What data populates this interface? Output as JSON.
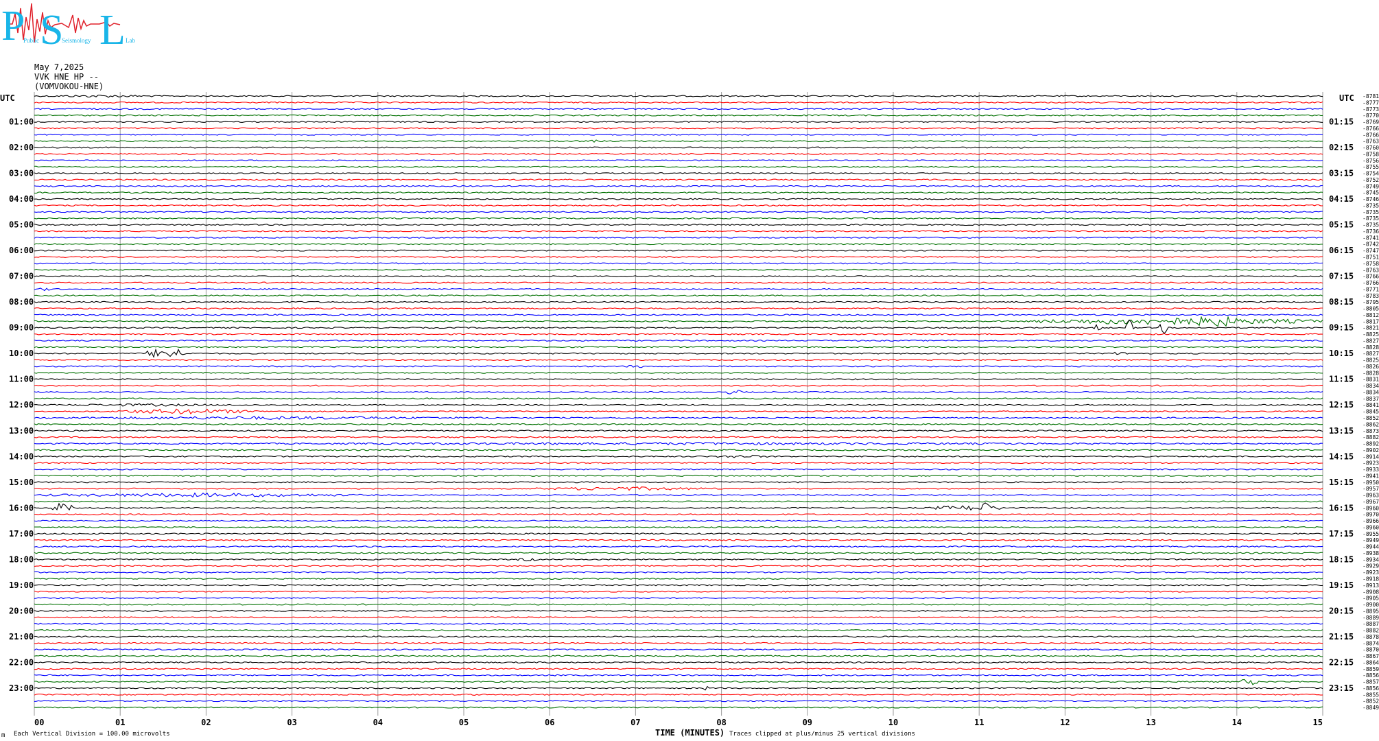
{
  "logo": {
    "letters": [
      "P",
      "S",
      "L"
    ],
    "small_words": [
      "Public",
      "Seismology",
      "Lab"
    ]
  },
  "header": {
    "date": "May 7,2025",
    "station": "VVK HNE HP --",
    "channel": "(VOMVOKOU-HNE)"
  },
  "colors": {
    "black": "#000000",
    "red": "#ff0000",
    "blue": "#0000ff",
    "green": "#007000",
    "grid": "#9a9a9a",
    "logo": "#19b5e8",
    "logo_signal": "#e0202a"
  },
  "chart_data": {
    "type": "line",
    "description_of_rows": "helicorder: one trace per 15 minutes, colours cycle black, red, blue, green",
    "left_axis_title": "UTC",
    "right_axis_title": "UTC",
    "left_labels": [
      "01:00",
      "02:00",
      "03:00",
      "04:00",
      "05:00",
      "06:00",
      "07:00",
      "08:00",
      "09:00",
      "10:00",
      "11:00",
      "12:00",
      "13:00",
      "14:00",
      "15:00",
      "16:00",
      "17:00",
      "18:00",
      "19:00",
      "20:00",
      "21:00",
      "22:00",
      "23:00"
    ],
    "right_labels": [
      "01:15",
      "02:15",
      "03:15",
      "04:15",
      "05:15",
      "06:15",
      "07:15",
      "08:15",
      "09:15",
      "10:15",
      "11:15",
      "12:15",
      "13:15",
      "14:15",
      "15:15",
      "16:15",
      "17:15",
      "18:15",
      "19:15",
      "20:15",
      "21:15",
      "22:15",
      "23:15"
    ],
    "trace_colors": [
      "#000000",
      "#ff0000",
      "#0000ff",
      "#007000"
    ],
    "row_counts": [
      -8781,
      -8777,
      -8773,
      -8770,
      -8769,
      -8766,
      -8766,
      -8763,
      -8760,
      -8758,
      -8756,
      -8755,
      -8754,
      -8752,
      -8749,
      -8745,
      -8746,
      -8735,
      -8735,
      -8735,
      -8735,
      -8736,
      -8741,
      -8742,
      -8747,
      -8751,
      -8758,
      -8763,
      -8766,
      -8766,
      -8771,
      -8783,
      -8795,
      -8805,
      -8812,
      -8817,
      -8821,
      -8825,
      -8827,
      -8828,
      -8827,
      -8825,
      -8826,
      -8828,
      -8831,
      -8834,
      -8834,
      -8837,
      -8841,
      -8845,
      -8852,
      -8862,
      -8873,
      -8882,
      -8892,
      -8902,
      -8914,
      -8923,
      -8933,
      -8941,
      -8950,
      -8957,
      -8963,
      -8967,
      -8960,
      -8970,
      -8966,
      -8960,
      -8955,
      -8949,
      -8944,
      -8938,
      -8934,
      -8929,
      -8923,
      -8918,
      -8913,
      -8908,
      -8905,
      -8900,
      -8895,
      -8889,
      -8887,
      -8882,
      -8878,
      -8874,
      -8870,
      -8867,
      -8864,
      -8859,
      -8856,
      -8857,
      -8856,
      -8855,
      -8852,
      -8849
    ],
    "x_ticks": [
      "00",
      "01",
      "02",
      "03",
      "04",
      "05",
      "06",
      "07",
      "08",
      "09",
      "10",
      "11",
      "12",
      "13",
      "14",
      "15"
    ],
    "x_label": "TIME (MINUTES)",
    "x_range": [
      0,
      15
    ],
    "rows": 96,
    "minutes_per_row": 15,
    "grid": true,
    "events": [
      {
        "row": 0,
        "start_min": 0.0,
        "end_min": 1.6,
        "amp": 2.0
      },
      {
        "row": 7,
        "start_min": 6.45,
        "end_min": 6.55,
        "amp": 3.5
      },
      {
        "row": 14,
        "start_min": 0.2,
        "end_min": 0.3,
        "amp": 2.5
      },
      {
        "row": 30,
        "start_min": 0.05,
        "end_min": 0.2,
        "amp": 2.5
      },
      {
        "row": 35,
        "start_min": 11.6,
        "end_min": 15.0,
        "amp": 5.5
      },
      {
        "row": 35,
        "start_min": 13.4,
        "end_min": 14.1,
        "amp": 9.0
      },
      {
        "row": 36,
        "start_min": 12.3,
        "end_min": 12.45,
        "amp": 5.0
      },
      {
        "row": 36,
        "start_min": 12.7,
        "end_min": 12.8,
        "amp": 12.0
      },
      {
        "row": 36,
        "start_min": 13.1,
        "end_min": 13.2,
        "amp": 10.0
      },
      {
        "row": 38,
        "start_min": 8.9,
        "end_min": 8.95,
        "amp": 5.0
      },
      {
        "row": 40,
        "start_min": 1.3,
        "end_min": 1.8,
        "amp": 9.0
      },
      {
        "row": 40,
        "start_min": 12.5,
        "end_min": 12.8,
        "amp": 2.5
      },
      {
        "row": 42,
        "start_min": 6.9,
        "end_min": 7.1,
        "amp": 3.0
      },
      {
        "row": 46,
        "start_min": 8.0,
        "end_min": 8.3,
        "amp": 3.5
      },
      {
        "row": 48,
        "start_min": 0.0,
        "end_min": 2.5,
        "amp": 2.0
      },
      {
        "row": 49,
        "start_min": 0.9,
        "end_min": 2.6,
        "amp": 4.0
      },
      {
        "row": 50,
        "start_min": 0.0,
        "end_min": 5.4,
        "amp": 2.5
      },
      {
        "row": 54,
        "start_min": 1.8,
        "end_min": 13.6,
        "amp": 2.0
      },
      {
        "row": 56,
        "start_min": 7.9,
        "end_min": 8.6,
        "amp": 2.5
      },
      {
        "row": 61,
        "start_min": 5.8,
        "end_min": 8.0,
        "amp": 2.8
      },
      {
        "row": 62,
        "start_min": 0.0,
        "end_min": 3.9,
        "amp": 3.0
      },
      {
        "row": 64,
        "start_min": 0.2,
        "end_min": 0.45,
        "amp": 8.0
      },
      {
        "row": 64,
        "start_min": 10.4,
        "end_min": 11.4,
        "amp": 4.0
      },
      {
        "row": 64,
        "start_min": 11.0,
        "end_min": 11.15,
        "amp": 9.0
      },
      {
        "row": 72,
        "start_min": 5.6,
        "end_min": 5.9,
        "amp": 2.5
      },
      {
        "row": 74,
        "start_min": 2.25,
        "end_min": 2.35,
        "amp": 3.0
      },
      {
        "row": 91,
        "start_min": 14.05,
        "end_min": 14.25,
        "amp": 6.0
      },
      {
        "row": 92,
        "start_min": 7.8,
        "end_min": 7.85,
        "amp": 7.0
      },
      {
        "row": 93,
        "start_min": 5.1,
        "end_min": 5.15,
        "amp": 3.0
      }
    ]
  },
  "footer": {
    "scale_note": "Each Vertical Division =  100.00 microvolts",
    "clip_note": "Traces clipped at plus/minus 25 vertical divisions",
    "corner_mark": "m"
  }
}
